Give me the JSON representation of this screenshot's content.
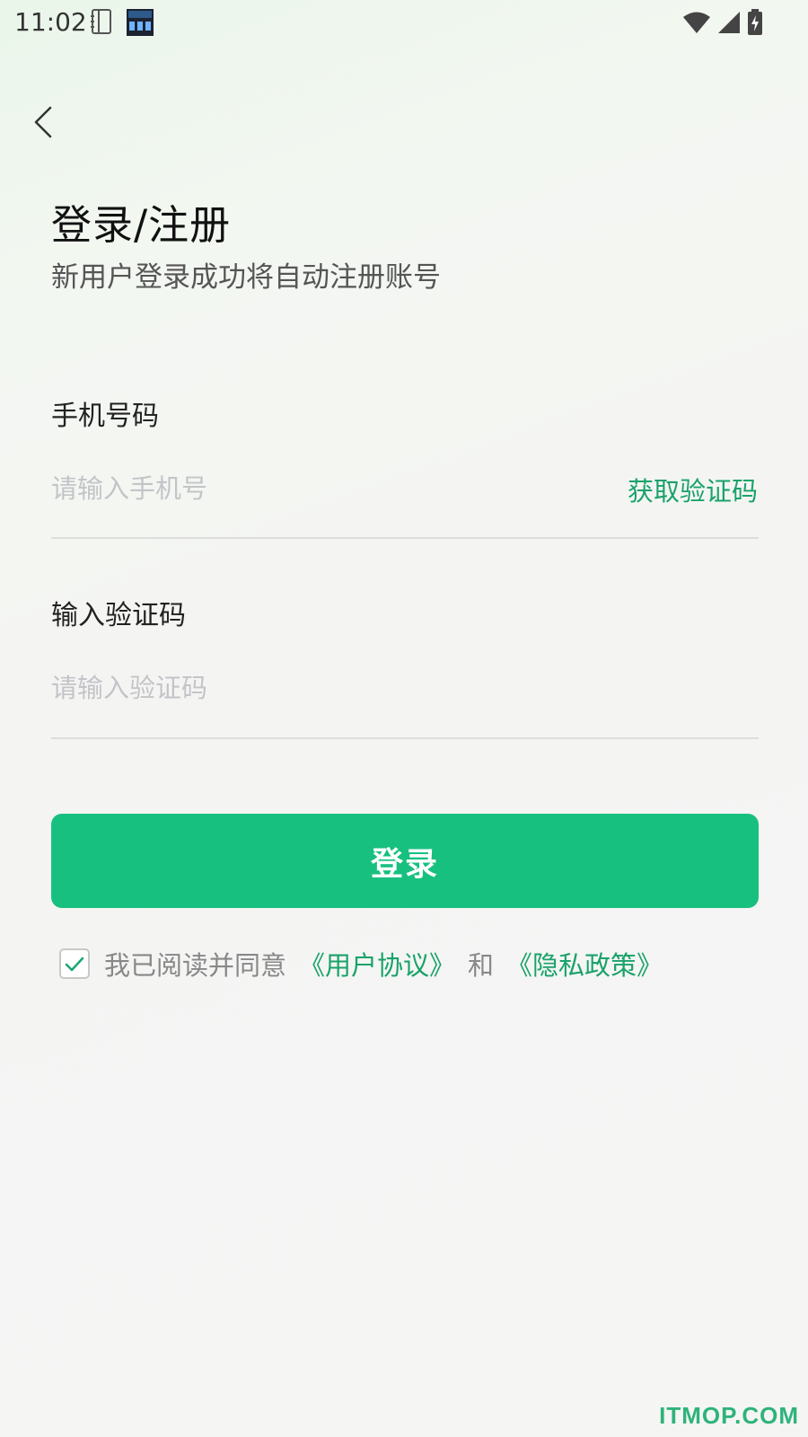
{
  "status_bar": {
    "time": "11:02",
    "icons": [
      "notebook-icon",
      "clock-widget-icon",
      "wifi-icon",
      "cellular-signal-icon",
      "battery-charging-icon"
    ]
  },
  "header": {
    "back_icon": "chevron-left-icon",
    "title": "登录/注册",
    "subtitle": "新用户登录成功将自动注册账号"
  },
  "form": {
    "phone": {
      "label": "手机号码",
      "placeholder": "请输入手机号",
      "value": "",
      "action_label": "获取验证码"
    },
    "code": {
      "label": "输入验证码",
      "placeholder": "请输入验证码",
      "value": ""
    },
    "submit_label": "登录"
  },
  "agreement": {
    "checked": true,
    "prefix": "我已阅读并同意",
    "user_agreement": "《用户协议》",
    "conjunction": "和",
    "privacy_policy": "《隐私政策》"
  },
  "watermark": "ITMOP.COM",
  "colors": {
    "accent": "#18c07f",
    "link": "#1aa26a",
    "placeholder": "#c4c4c8",
    "background": "#f5f5f4"
  }
}
